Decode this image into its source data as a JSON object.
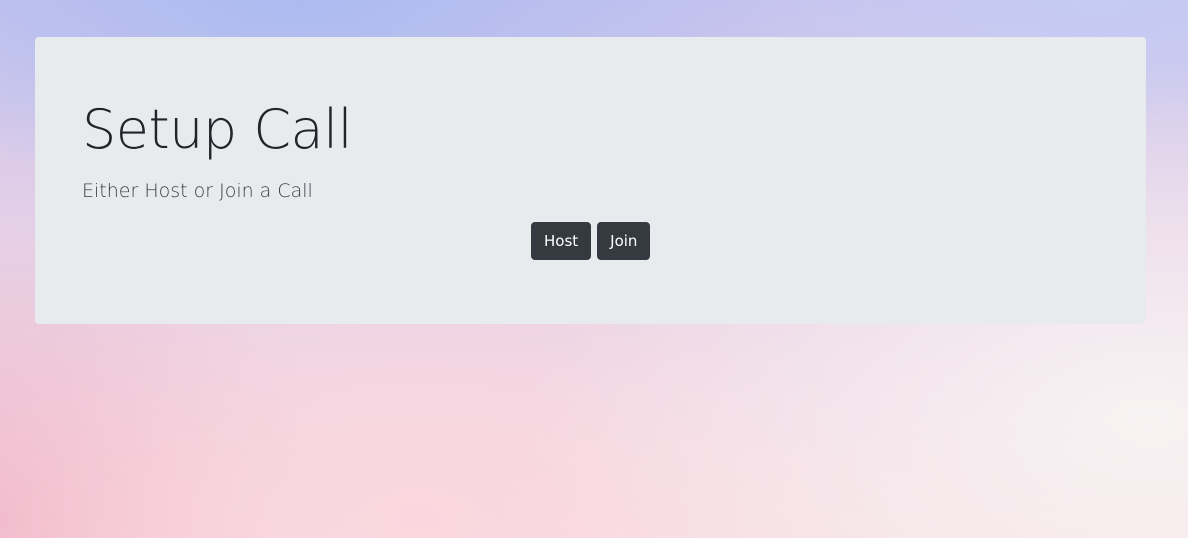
{
  "setup": {
    "title": "Setup Call",
    "subtitle": "Either Host or Join a Call",
    "host_label": "Host",
    "join_label": "Join"
  }
}
